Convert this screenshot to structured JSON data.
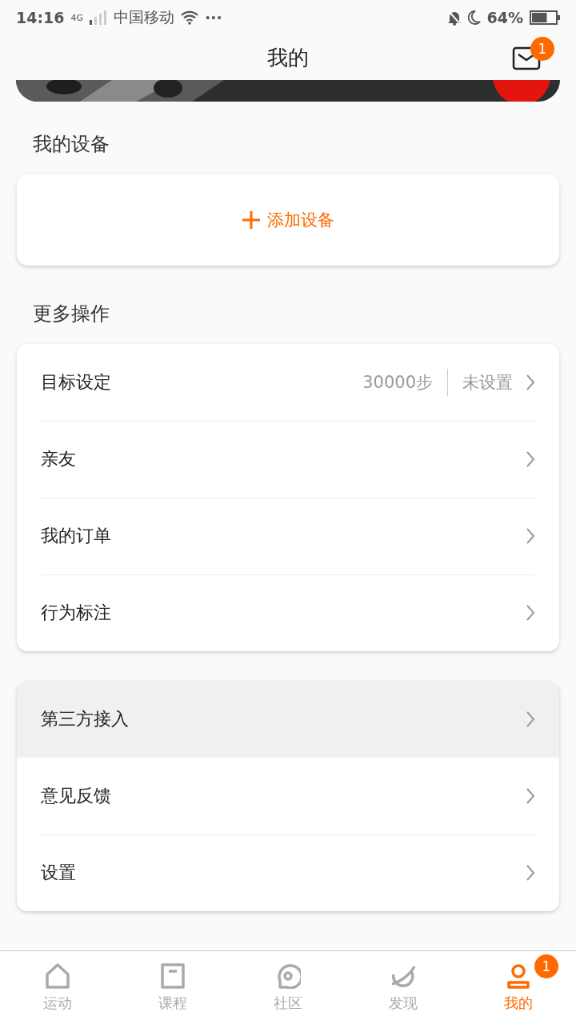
{
  "status_bar": {
    "time": "14:16",
    "network": "4G",
    "carrier": "中国移动",
    "more": "···",
    "battery": "64%"
  },
  "header": {
    "title": "我的",
    "mail_badge": "1"
  },
  "devices": {
    "title": "我的设备",
    "add_label": "添加设备"
  },
  "more_actions": {
    "title": "更多操作",
    "rows": [
      {
        "label": "目标设定",
        "value": "30000步",
        "status": "未设置"
      },
      {
        "label": "亲友"
      },
      {
        "label": "我的订单"
      },
      {
        "label": "行为标注"
      }
    ]
  },
  "other_actions": {
    "rows": [
      {
        "label": "第三方接入",
        "highlighted": true
      },
      {
        "label": "意见反馈",
        "highlighted": false
      },
      {
        "label": "设置",
        "highlighted": false
      }
    ]
  },
  "tabs": [
    {
      "label": "运动",
      "selected": false
    },
    {
      "label": "课程",
      "selected": false
    },
    {
      "label": "社区",
      "selected": false
    },
    {
      "label": "发现",
      "selected": false
    },
    {
      "label": "我的",
      "selected": true,
      "badge": "1"
    }
  ]
}
